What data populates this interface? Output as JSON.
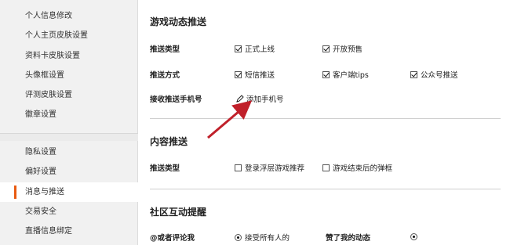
{
  "sidebar": {
    "group1": [
      "个人信息修改",
      "个人主页皮肤设置",
      "资料卡皮肤设置",
      "头像框设置",
      "评测皮肤设置",
      "徽章设置"
    ],
    "group2": [
      "隐私设置",
      "偏好设置",
      "消息与推送",
      "交易安全",
      "直播信息绑定"
    ],
    "active": "消息与推送"
  },
  "main": {
    "game_push": {
      "title": "游戏动态推送",
      "type_label": "推送类型",
      "type_options": [
        {
          "label": "正式上线",
          "checked": true
        },
        {
          "label": "开放预售",
          "checked": true
        }
      ],
      "method_label": "推送方式",
      "method_options": [
        {
          "label": "短信推送",
          "checked": true
        },
        {
          "label": "客户端tips",
          "checked": true
        },
        {
          "label": "公众号推送",
          "checked": true
        }
      ],
      "phone_label": "接收推送手机号",
      "add_phone": "添加手机号"
    },
    "content_push": {
      "title": "内容推送",
      "type_label": "推送类型",
      "options": [
        {
          "label": "登录浮层游戏推荐",
          "checked": false
        },
        {
          "label": "游戏结束后的弹框",
          "checked": false
        }
      ]
    },
    "community": {
      "title": "社区互动提醒",
      "at_label": "@或者评论我",
      "at_option": "接受所有人的",
      "like_label": "赞了我的动态"
    }
  },
  "colors": {
    "accent": "#e95a11",
    "arrow": "#c0202a",
    "sidebar_bg": "#f1f1f1"
  }
}
